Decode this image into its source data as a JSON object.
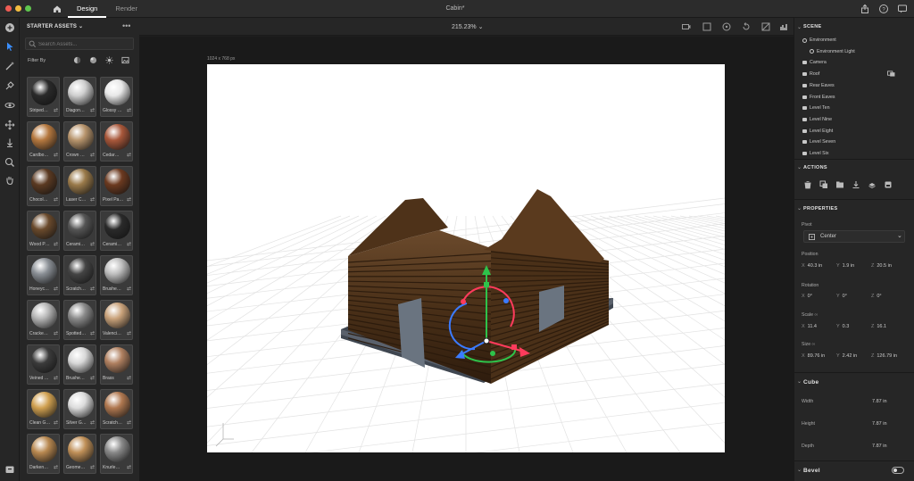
{
  "title_bar": {
    "tabs": [
      "Design",
      "Render"
    ],
    "active_tab": "Design",
    "document_title": "Cabin*"
  },
  "starter_assets": {
    "header": "STARTER ASSETS",
    "search_placeholder": "Search Assets...",
    "filter_label": "Filter By",
    "items": [
      {
        "label": "Striped…",
        "color": "#2a2a2a"
      },
      {
        "label": "Diagon…",
        "color": "#cfcfcf"
      },
      {
        "label": "Glossy …",
        "color": "#e8e8e8"
      },
      {
        "label": "Cardbo…",
        "color": "#b5783f"
      },
      {
        "label": "Crown …",
        "color": "#b7946c"
      },
      {
        "label": "Cedar…",
        "color": "#a8573a"
      },
      {
        "label": "Chocol…",
        "color": "#5b3a22"
      },
      {
        "label": "Laser C…",
        "color": "#9a7a4a"
      },
      {
        "label": "Pixel Pa…",
        "color": "#6c3a20"
      },
      {
        "label": "Wood P…",
        "color": "#6a4a2c"
      },
      {
        "label": "Cerami…",
        "color": "#555555"
      },
      {
        "label": "Cerami…",
        "color": "#2a2a2a"
      },
      {
        "label": "Honeyc…",
        "color": "#8a8f95"
      },
      {
        "label": "Scratch…",
        "color": "#444444"
      },
      {
        "label": "Brushe…",
        "color": "#bdbdbd"
      },
      {
        "label": "Cracke…",
        "color": "#b5b5b5"
      },
      {
        "label": "Spotted…",
        "color": "#8a8a8a"
      },
      {
        "label": "Valenci…",
        "color": "#c9a27a"
      },
      {
        "label": "Veined …",
        "color": "#3b3b3b"
      },
      {
        "label": "Brushe…",
        "color": "#d8d8d8"
      },
      {
        "label": "Brass",
        "color": "#b08060"
      },
      {
        "label": "Clean G…",
        "color": "#d0a050"
      },
      {
        "label": "Silver G…",
        "color": "#dcdcdc"
      },
      {
        "label": "Scratch…",
        "color": "#b07850"
      },
      {
        "label": "Darken…",
        "color": "#b88850"
      },
      {
        "label": "Geome…",
        "color": "#c09058"
      },
      {
        "label": "Knurle…",
        "color": "#888888"
      }
    ]
  },
  "viewport": {
    "zoom": "215.23%",
    "canvas_size": "1024 x 768 px"
  },
  "scene": {
    "header": "SCENE",
    "items": [
      {
        "label": "Environment",
        "icon": "globe-icon",
        "indent": 0
      },
      {
        "label": "Environment Light",
        "icon": "globe-icon",
        "indent": 1
      },
      {
        "label": "Camera",
        "icon": "folder-icon",
        "indent": 0
      },
      {
        "label": "Roof",
        "icon": "folder-icon",
        "indent": 0
      },
      {
        "label": "Rear Eaves",
        "icon": "folder-icon",
        "indent": 0
      },
      {
        "label": "Front Eaves",
        "icon": "folder-icon",
        "indent": 0
      },
      {
        "label": "Level Ten",
        "icon": "folder-icon",
        "indent": 0
      },
      {
        "label": "Level Nine",
        "icon": "folder-icon",
        "indent": 0
      },
      {
        "label": "Level Eight",
        "icon": "folder-icon",
        "indent": 0
      },
      {
        "label": "Level Seven",
        "icon": "folder-icon",
        "indent": 0
      },
      {
        "label": "Level Six",
        "icon": "folder-icon",
        "indent": 0
      }
    ]
  },
  "actions": {
    "header": "ACTIONS",
    "icons": [
      "delete-icon",
      "duplicate-icon",
      "group-icon",
      "download-icon",
      "drop-icon",
      "paint-icon"
    ]
  },
  "properties": {
    "header": "PROPERTIES",
    "pivot_label": "Pivot",
    "pivot_value": "Center",
    "position": {
      "label": "Position",
      "x": "40.3 in",
      "y": "1.9 in",
      "z": "20.5 in"
    },
    "rotation": {
      "label": "Rotation",
      "x": "0°",
      "y": "0°",
      "z": "0°"
    },
    "scale": {
      "label": "Scale",
      "x": "11.4",
      "y": "0.3",
      "z": "16.1"
    },
    "size": {
      "label": "Size",
      "x": "89.76 in",
      "y": "2.42 in",
      "z": "126.79 in"
    },
    "axis_labels": [
      "X",
      "Y",
      "Z"
    ]
  },
  "cube": {
    "header": "Cube",
    "width_label": "Width",
    "width_value": "7.87 in",
    "height_label": "Height",
    "height_value": "7.87 in",
    "depth_label": "Depth",
    "depth_value": "7.87 in"
  },
  "bevel": {
    "header": "Bevel"
  }
}
